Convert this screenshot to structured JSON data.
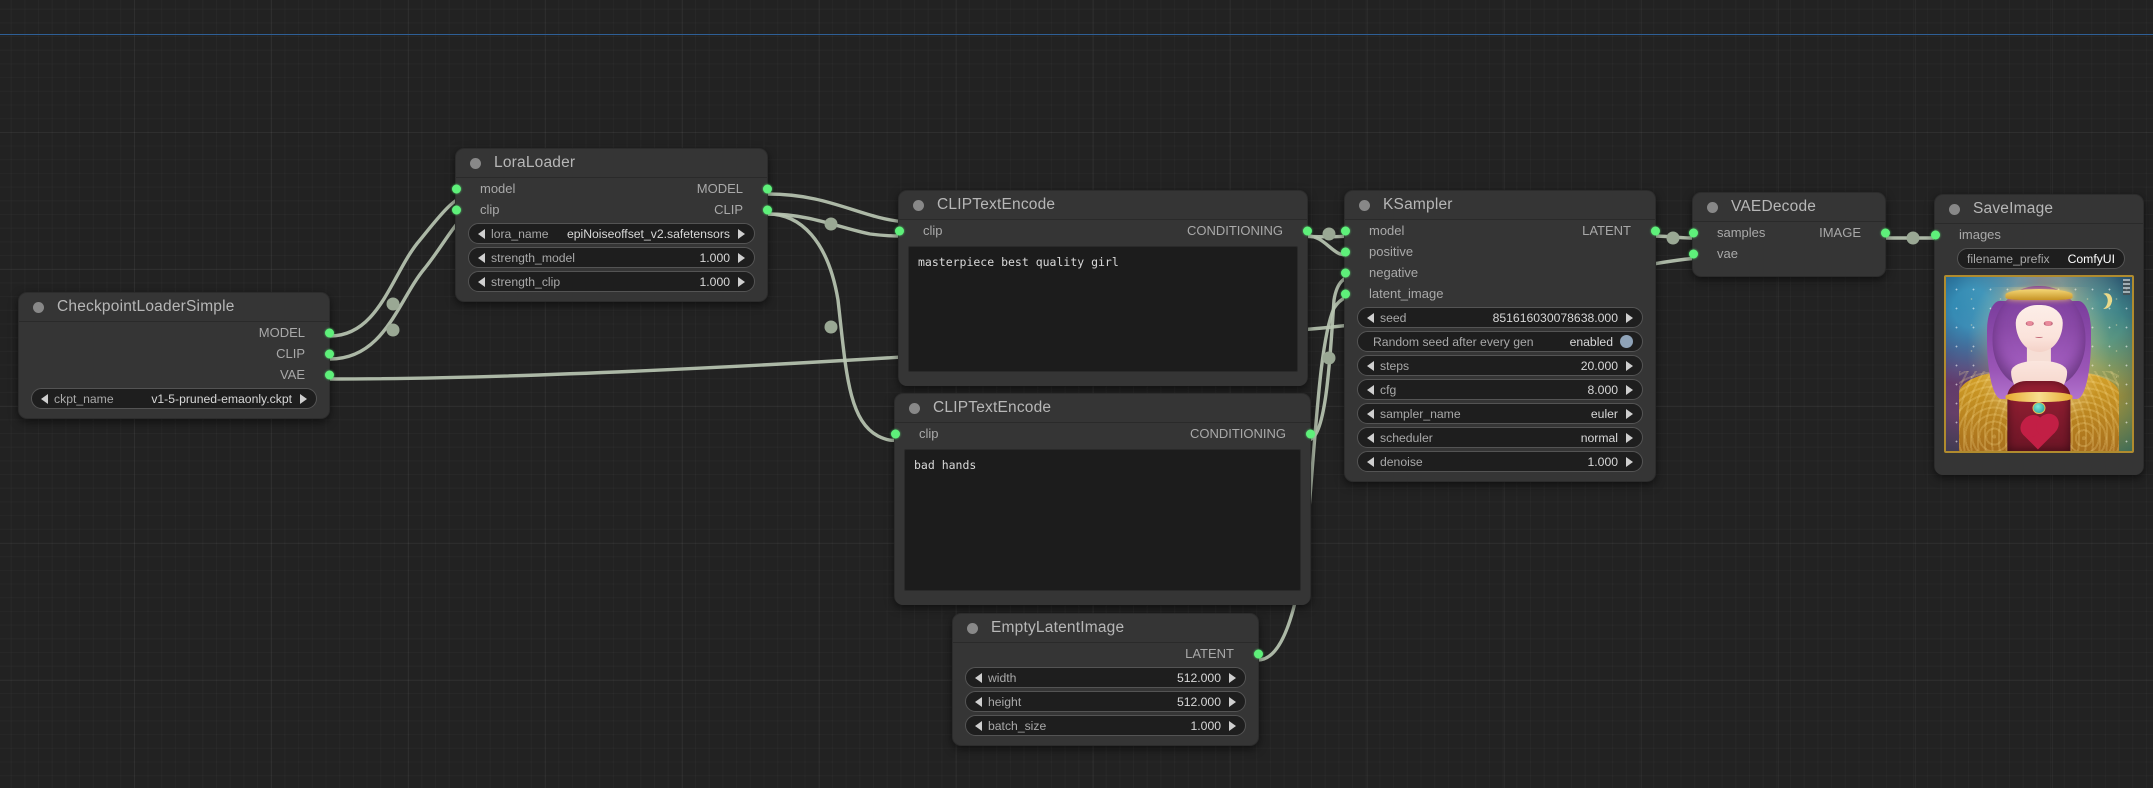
{
  "app": {
    "name": "ComfyUI",
    "canvas_background": "#222222",
    "wire_color": "#b9c5b2",
    "slot_color": "#5ef07a",
    "guide_line_color": "#2e5f96"
  },
  "nodes": [
    {
      "id": "checkpoint_loader",
      "title": "CheckpointLoaderSimple",
      "inputs": [],
      "outputs": [
        {
          "label": "MODEL"
        },
        {
          "label": "CLIP"
        },
        {
          "label": "VAE"
        }
      ],
      "widgets": [
        {
          "type": "combo",
          "label": "ckpt_name",
          "value": "v1-5-pruned-emaonly.ckpt"
        }
      ]
    },
    {
      "id": "lora_loader",
      "title": "LoraLoader",
      "inputs": [
        {
          "label": "model"
        },
        {
          "label": "clip"
        }
      ],
      "outputs": [
        {
          "label": "MODEL"
        },
        {
          "label": "CLIP"
        }
      ],
      "widgets": [
        {
          "type": "combo",
          "label": "lora_name",
          "value": "epiNoiseoffset_v2.safetensors"
        },
        {
          "type": "number",
          "label": "strength_model",
          "value": "1.000"
        },
        {
          "type": "number",
          "label": "strength_clip",
          "value": "1.000"
        }
      ]
    },
    {
      "id": "clip_text_encode_positive",
      "title": "CLIPTextEncode",
      "inputs": [
        {
          "label": "clip"
        }
      ],
      "outputs": [
        {
          "label": "CONDITIONING"
        }
      ],
      "text": "masterpiece best quality girl"
    },
    {
      "id": "clip_text_encode_negative",
      "title": "CLIPTextEncode",
      "inputs": [
        {
          "label": "clip"
        }
      ],
      "outputs": [
        {
          "label": "CONDITIONING"
        }
      ],
      "text": "bad hands"
    },
    {
      "id": "empty_latent_image",
      "title": "EmptyLatentImage",
      "inputs": [],
      "outputs": [
        {
          "label": "LATENT"
        }
      ],
      "widgets": [
        {
          "type": "number",
          "label": "width",
          "value": "512.000"
        },
        {
          "type": "number",
          "label": "height",
          "value": "512.000"
        },
        {
          "type": "number",
          "label": "batch_size",
          "value": "1.000"
        }
      ]
    },
    {
      "id": "ksampler",
      "title": "KSampler",
      "inputs": [
        {
          "label": "model"
        },
        {
          "label": "positive"
        },
        {
          "label": "negative"
        },
        {
          "label": "latent_image"
        }
      ],
      "outputs": [
        {
          "label": "LATENT"
        }
      ],
      "widgets": [
        {
          "type": "number",
          "label": "seed",
          "value": "851616030078638.000"
        },
        {
          "type": "toggle",
          "label": "Random seed after every gen",
          "value": "enabled"
        },
        {
          "type": "number",
          "label": "steps",
          "value": "20.000"
        },
        {
          "type": "number",
          "label": "cfg",
          "value": "8.000"
        },
        {
          "type": "combo",
          "label": "sampler_name",
          "value": "euler"
        },
        {
          "type": "combo",
          "label": "scheduler",
          "value": "normal"
        },
        {
          "type": "number",
          "label": "denoise",
          "value": "1.000"
        }
      ]
    },
    {
      "id": "vae_decode",
      "title": "VAEDecode",
      "inputs": [
        {
          "label": "samples"
        },
        {
          "label": "vae"
        }
      ],
      "outputs": [
        {
          "label": "IMAGE"
        }
      ],
      "widgets": []
    },
    {
      "id": "save_image",
      "title": "SaveImage",
      "inputs": [
        {
          "label": "images"
        }
      ],
      "outputs": [],
      "widgets": [
        {
          "type": "text",
          "label": "filename_prefix",
          "value": "ComfyUI"
        }
      ],
      "preview_alt": "anime girl with purple hair in ornate golden dress on cosmic nebula background"
    }
  ]
}
